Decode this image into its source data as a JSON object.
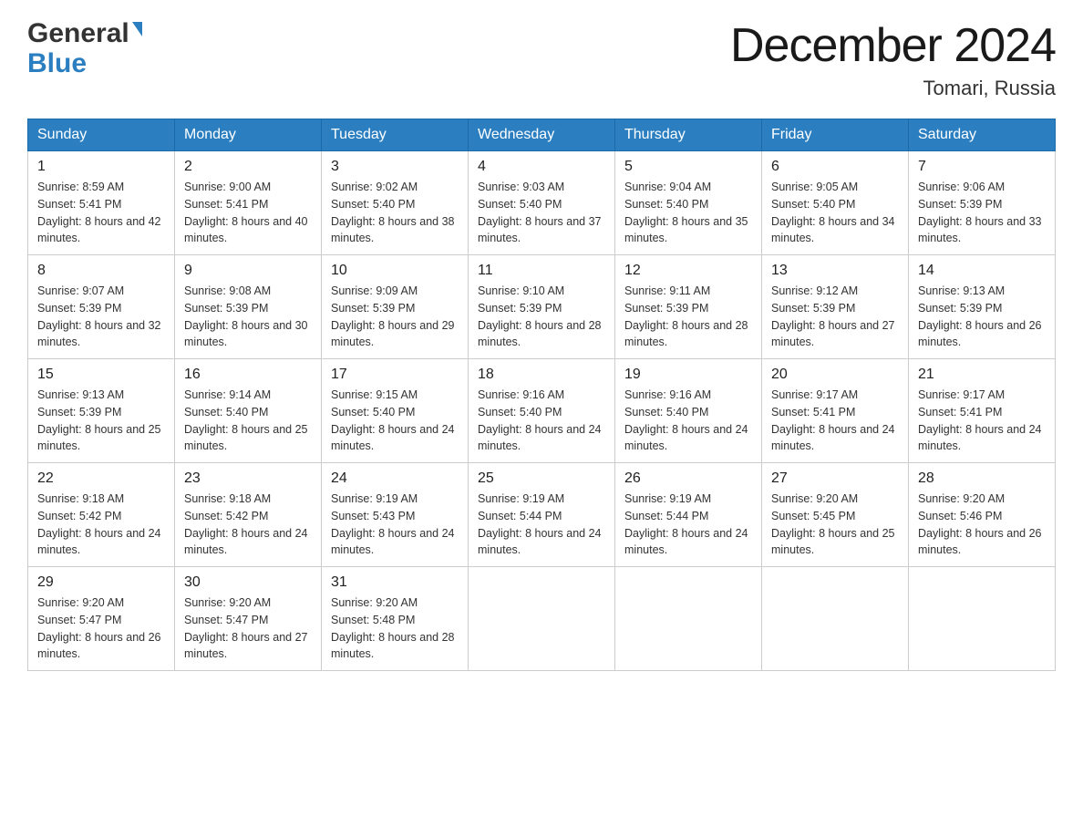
{
  "header": {
    "logo_general": "General",
    "logo_blue": "Blue",
    "month_title": "December 2024",
    "location": "Tomari, Russia"
  },
  "weekdays": [
    "Sunday",
    "Monday",
    "Tuesday",
    "Wednesday",
    "Thursday",
    "Friday",
    "Saturday"
  ],
  "weeks": [
    [
      {
        "day": "1",
        "sunrise": "8:59 AM",
        "sunset": "5:41 PM",
        "daylight": "8 hours and 42 minutes."
      },
      {
        "day": "2",
        "sunrise": "9:00 AM",
        "sunset": "5:41 PM",
        "daylight": "8 hours and 40 minutes."
      },
      {
        "day": "3",
        "sunrise": "9:02 AM",
        "sunset": "5:40 PM",
        "daylight": "8 hours and 38 minutes."
      },
      {
        "day": "4",
        "sunrise": "9:03 AM",
        "sunset": "5:40 PM",
        "daylight": "8 hours and 37 minutes."
      },
      {
        "day": "5",
        "sunrise": "9:04 AM",
        "sunset": "5:40 PM",
        "daylight": "8 hours and 35 minutes."
      },
      {
        "day": "6",
        "sunrise": "9:05 AM",
        "sunset": "5:40 PM",
        "daylight": "8 hours and 34 minutes."
      },
      {
        "day": "7",
        "sunrise": "9:06 AM",
        "sunset": "5:39 PM",
        "daylight": "8 hours and 33 minutes."
      }
    ],
    [
      {
        "day": "8",
        "sunrise": "9:07 AM",
        "sunset": "5:39 PM",
        "daylight": "8 hours and 32 minutes."
      },
      {
        "day": "9",
        "sunrise": "9:08 AM",
        "sunset": "5:39 PM",
        "daylight": "8 hours and 30 minutes."
      },
      {
        "day": "10",
        "sunrise": "9:09 AM",
        "sunset": "5:39 PM",
        "daylight": "8 hours and 29 minutes."
      },
      {
        "day": "11",
        "sunrise": "9:10 AM",
        "sunset": "5:39 PM",
        "daylight": "8 hours and 28 minutes."
      },
      {
        "day": "12",
        "sunrise": "9:11 AM",
        "sunset": "5:39 PM",
        "daylight": "8 hours and 28 minutes."
      },
      {
        "day": "13",
        "sunrise": "9:12 AM",
        "sunset": "5:39 PM",
        "daylight": "8 hours and 27 minutes."
      },
      {
        "day": "14",
        "sunrise": "9:13 AM",
        "sunset": "5:39 PM",
        "daylight": "8 hours and 26 minutes."
      }
    ],
    [
      {
        "day": "15",
        "sunrise": "9:13 AM",
        "sunset": "5:39 PM",
        "daylight": "8 hours and 25 minutes."
      },
      {
        "day": "16",
        "sunrise": "9:14 AM",
        "sunset": "5:40 PM",
        "daylight": "8 hours and 25 minutes."
      },
      {
        "day": "17",
        "sunrise": "9:15 AM",
        "sunset": "5:40 PM",
        "daylight": "8 hours and 24 minutes."
      },
      {
        "day": "18",
        "sunrise": "9:16 AM",
        "sunset": "5:40 PM",
        "daylight": "8 hours and 24 minutes."
      },
      {
        "day": "19",
        "sunrise": "9:16 AM",
        "sunset": "5:40 PM",
        "daylight": "8 hours and 24 minutes."
      },
      {
        "day": "20",
        "sunrise": "9:17 AM",
        "sunset": "5:41 PM",
        "daylight": "8 hours and 24 minutes."
      },
      {
        "day": "21",
        "sunrise": "9:17 AM",
        "sunset": "5:41 PM",
        "daylight": "8 hours and 24 minutes."
      }
    ],
    [
      {
        "day": "22",
        "sunrise": "9:18 AM",
        "sunset": "5:42 PM",
        "daylight": "8 hours and 24 minutes."
      },
      {
        "day": "23",
        "sunrise": "9:18 AM",
        "sunset": "5:42 PM",
        "daylight": "8 hours and 24 minutes."
      },
      {
        "day": "24",
        "sunrise": "9:19 AM",
        "sunset": "5:43 PM",
        "daylight": "8 hours and 24 minutes."
      },
      {
        "day": "25",
        "sunrise": "9:19 AM",
        "sunset": "5:44 PM",
        "daylight": "8 hours and 24 minutes."
      },
      {
        "day": "26",
        "sunrise": "9:19 AM",
        "sunset": "5:44 PM",
        "daylight": "8 hours and 24 minutes."
      },
      {
        "day": "27",
        "sunrise": "9:20 AM",
        "sunset": "5:45 PM",
        "daylight": "8 hours and 25 minutes."
      },
      {
        "day": "28",
        "sunrise": "9:20 AM",
        "sunset": "5:46 PM",
        "daylight": "8 hours and 26 minutes."
      }
    ],
    [
      {
        "day": "29",
        "sunrise": "9:20 AM",
        "sunset": "5:47 PM",
        "daylight": "8 hours and 26 minutes."
      },
      {
        "day": "30",
        "sunrise": "9:20 AM",
        "sunset": "5:47 PM",
        "daylight": "8 hours and 27 minutes."
      },
      {
        "day": "31",
        "sunrise": "9:20 AM",
        "sunset": "5:48 PM",
        "daylight": "8 hours and 28 minutes."
      },
      null,
      null,
      null,
      null
    ]
  ],
  "labels": {
    "sunrise": "Sunrise:",
    "sunset": "Sunset:",
    "daylight": "Daylight:"
  }
}
